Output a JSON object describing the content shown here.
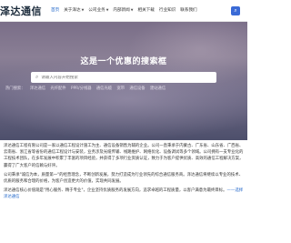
{
  "header": {
    "logo": "泽达通信",
    "nav": [
      {
        "label": "首页",
        "dropdown": false,
        "active": true
      },
      {
        "label": "关于泽达",
        "dropdown": true,
        "active": false
      },
      {
        "label": "公司业务",
        "dropdown": true,
        "active": false
      },
      {
        "label": "内部新闻",
        "dropdown": true,
        "active": false
      },
      {
        "label": "相关下载",
        "dropdown": false,
        "active": false
      },
      {
        "label": "行业知识",
        "dropdown": false,
        "active": false
      },
      {
        "label": "联系我们",
        "dropdown": false,
        "active": false
      }
    ],
    "search_icon": "search-icon"
  },
  "hero": {
    "title": "这是一个优惠的搜索框",
    "search_placeholder": "请输入内容开始搜索",
    "hot_tags": [
      "热门搜索：",
      "泽达通信",
      "光纤配件",
      "PPR/分线器",
      "通信光缆",
      "宽带",
      "通信设备",
      "建站通信"
    ]
  },
  "content": {
    "paragraphs": [
      "泽达通信工程有限公司是一家以通信工程设计施工为主、通信设备销售为辅的企业。公司一直秉承于内蒙古、广东省、山东省、广西省、云南省、浙江省等省份的通信工程设计与安装，业务涉及光缆传输、线路维护、网络优化、设备调试等多个领域。公司拥有一支专业化的工程技术团队，在多年发展中积累了丰富的项目经验，并获得了多项行业资质认证，致力于为客户提供优质、高效的通信工程解决方案，赢得了广大客户的信赖与好评。",
      "公司秉承\"诚信为本，质量第一\"的经营理念，不断创新发展，努力打造成为行业领先的综合通信服务商。泽达通信将继续以专业的技术、优质的服务和合理的价格，为客户创造更大的价值，实现共同发展。",
      "泽达通信核心价值观是\"用心服务、精于专业\"，企业坚持优质服务的发展方向，追求卓越的工程质量，以客户满意为最终目标。"
    ],
    "closing": "——选择泽达通信"
  }
}
